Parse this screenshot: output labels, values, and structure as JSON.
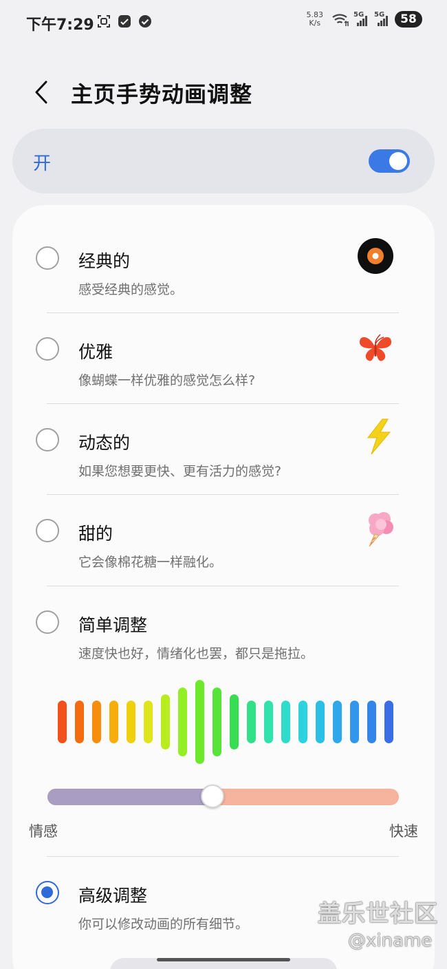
{
  "status_bar": {
    "time": "下午7:29",
    "speed_value": "5.83",
    "speed_unit": "K/s",
    "signal1_tag": "5G",
    "signal2_tag": "5G",
    "battery": "58"
  },
  "header": {
    "title": "主页手势动画调整"
  },
  "master": {
    "label": "开",
    "enabled": true
  },
  "options": [
    {
      "title": "经典的",
      "desc": "感受经典的感觉。",
      "icon": "vinyl-record-icon",
      "selected": false
    },
    {
      "title": "优雅",
      "desc": "像蝴蝶一样优雅的感觉怎么样?",
      "icon": "butterfly-icon",
      "selected": false
    },
    {
      "title": "动态的",
      "desc": "如果您想要更快、更有活力的感觉?",
      "icon": "lightning-icon",
      "selected": false
    },
    {
      "title": "甜的",
      "desc": "它会像棉花糖一样融化。",
      "icon": "cotton-candy-icon",
      "selected": false
    },
    {
      "title": "简单调整",
      "desc": "速度快也好，情绪化也罢，都只是拖拉。",
      "icon": "",
      "selected": false
    },
    {
      "title": "高级调整",
      "desc": "你可以修改动画的所有细节。",
      "icon": "",
      "selected": true
    }
  ],
  "simple_adjust": {
    "slider_value": 0.47,
    "min_label": "情感",
    "max_label": "快速"
  },
  "colors": {
    "accent": "#2f6ad8",
    "toggle_on": "#3b7ae6",
    "slider_left": "#a99dc4",
    "slider_right": "#f6b39d"
  },
  "watermark": {
    "main": "盖乐世社区",
    "sub": "@xiname"
  }
}
